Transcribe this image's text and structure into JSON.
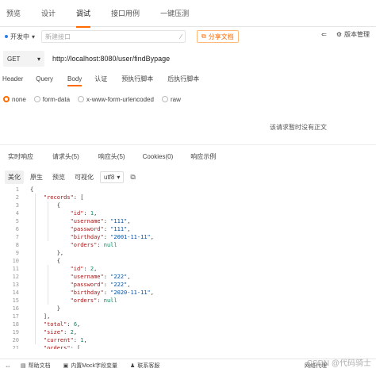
{
  "top_tabs": [
    "预览",
    "设计",
    "调试",
    "接口用例",
    "一键压测"
  ],
  "env": {
    "label": "开发中"
  },
  "name_input": {
    "placeholder": "新建接口"
  },
  "share_button": "分享文档",
  "version_mgmt": "版本管理",
  "url_bar": {
    "method": "GET",
    "url": "http://localhost:8080/user/findBypage"
  },
  "request_tabs": [
    "Header",
    "Query",
    "Body",
    "认证",
    "预执行脚本",
    "后执行脚本"
  ],
  "body_types": [
    "none",
    "form-data",
    "x-www-form-urlencoded",
    "raw"
  ],
  "no_body_text": "该请求暂时没有正文",
  "response_tabs": [
    "实时响应",
    "请求头(5)",
    "响应头(5)",
    "Cookies(0)",
    "响应示例"
  ],
  "view_tools": [
    "美化",
    "原生",
    "预览",
    "可视化"
  ],
  "encoding": "utf8",
  "code_lines": [
    [
      {
        "t": "{",
        "c": ""
      }
    ],
    [
      {
        "t": "    ",
        "c": ""
      },
      {
        "t": "\"records\"",
        "c": "k"
      },
      {
        "t": ": [",
        "c": ""
      }
    ],
    [
      {
        "t": "        {",
        "c": ""
      }
    ],
    [
      {
        "t": "            ",
        "c": ""
      },
      {
        "t": "\"id\"",
        "c": "k"
      },
      {
        "t": ": ",
        "c": ""
      },
      {
        "t": "1",
        "c": "n"
      },
      {
        "t": ",",
        "c": ""
      }
    ],
    [
      {
        "t": "            ",
        "c": ""
      },
      {
        "t": "\"username\"",
        "c": "k"
      },
      {
        "t": ": ",
        "c": ""
      },
      {
        "t": "\"111\"",
        "c": "s"
      },
      {
        "t": ",",
        "c": ""
      }
    ],
    [
      {
        "t": "            ",
        "c": ""
      },
      {
        "t": "\"password\"",
        "c": "k"
      },
      {
        "t": ": ",
        "c": ""
      },
      {
        "t": "\"111\"",
        "c": "s"
      },
      {
        "t": ",",
        "c": ""
      }
    ],
    [
      {
        "t": "            ",
        "c": ""
      },
      {
        "t": "\"birthday\"",
        "c": "k"
      },
      {
        "t": ": ",
        "c": ""
      },
      {
        "t": "\"2001-11-11\"",
        "c": "s"
      },
      {
        "t": ",",
        "c": ""
      }
    ],
    [
      {
        "t": "            ",
        "c": ""
      },
      {
        "t": "\"orders\"",
        "c": "k"
      },
      {
        "t": ": ",
        "c": ""
      },
      {
        "t": "null",
        "c": "n"
      }
    ],
    [
      {
        "t": "        },",
        "c": ""
      }
    ],
    [
      {
        "t": "        {",
        "c": ""
      }
    ],
    [
      {
        "t": "            ",
        "c": ""
      },
      {
        "t": "\"id\"",
        "c": "k"
      },
      {
        "t": ": ",
        "c": ""
      },
      {
        "t": "2",
        "c": "n"
      },
      {
        "t": ",",
        "c": ""
      }
    ],
    [
      {
        "t": "            ",
        "c": ""
      },
      {
        "t": "\"username\"",
        "c": "k"
      },
      {
        "t": ": ",
        "c": ""
      },
      {
        "t": "\"222\"",
        "c": "s"
      },
      {
        "t": ",",
        "c": ""
      }
    ],
    [
      {
        "t": "            ",
        "c": ""
      },
      {
        "t": "\"password\"",
        "c": "k"
      },
      {
        "t": ": ",
        "c": ""
      },
      {
        "t": "\"222\"",
        "c": "s"
      },
      {
        "t": ",",
        "c": ""
      }
    ],
    [
      {
        "t": "            ",
        "c": ""
      },
      {
        "t": "\"birthday\"",
        "c": "k"
      },
      {
        "t": ": ",
        "c": ""
      },
      {
        "t": "\"2020-11-11\"",
        "c": "s"
      },
      {
        "t": ",",
        "c": ""
      }
    ],
    [
      {
        "t": "            ",
        "c": ""
      },
      {
        "t": "\"orders\"",
        "c": "k"
      },
      {
        "t": ": ",
        "c": ""
      },
      {
        "t": "null",
        "c": "n"
      }
    ],
    [
      {
        "t": "        }",
        "c": ""
      }
    ],
    [
      {
        "t": "    ],",
        "c": ""
      }
    ],
    [
      {
        "t": "    ",
        "c": ""
      },
      {
        "t": "\"total\"",
        "c": "k"
      },
      {
        "t": ": ",
        "c": ""
      },
      {
        "t": "6",
        "c": "n"
      },
      {
        "t": ",",
        "c": ""
      }
    ],
    [
      {
        "t": "    ",
        "c": ""
      },
      {
        "t": "\"size\"",
        "c": "k"
      },
      {
        "t": ": ",
        "c": ""
      },
      {
        "t": "2",
        "c": "n"
      },
      {
        "t": ",",
        "c": ""
      }
    ],
    [
      {
        "t": "    ",
        "c": ""
      },
      {
        "t": "\"current\"",
        "c": "k"
      },
      {
        "t": ": ",
        "c": ""
      },
      {
        "t": "1",
        "c": "n"
      },
      {
        "t": ",",
        "c": ""
      }
    ],
    [
      {
        "t": "    ",
        "c": ""
      },
      {
        "t": "\"orders\"",
        "c": "k"
      },
      {
        "t": ": [",
        "c": ""
      }
    ]
  ],
  "status_bar": [
    "帮助文档",
    "内置Mock字段变量",
    "联系客服",
    "网络代理"
  ],
  "watermark": "CSDN @代码骑士",
  "colors": {
    "accent": "#ff6a00",
    "env_dot": "#2b7de9"
  }
}
